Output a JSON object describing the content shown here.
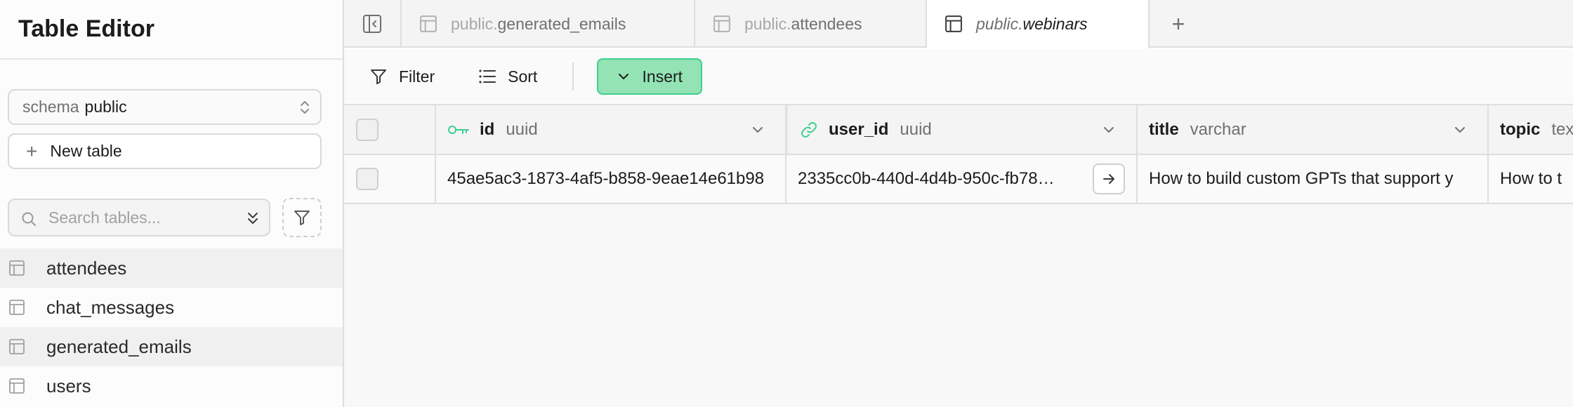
{
  "sidebar": {
    "title": "Table Editor",
    "schema": {
      "label": "schema",
      "value": "public"
    },
    "new_table_label": "New table",
    "search_placeholder": "Search tables...",
    "tables": [
      {
        "name": "attendees",
        "active": true
      },
      {
        "name": "chat_messages",
        "active": false
      },
      {
        "name": "generated_emails",
        "active": true
      },
      {
        "name": "users",
        "active": false
      }
    ]
  },
  "tabs": [
    {
      "schema": "public.",
      "name": "generated_emails",
      "active": false
    },
    {
      "schema": "public.",
      "name": "attendees",
      "active": false
    },
    {
      "schema": "public.",
      "name": "webinars",
      "active": true
    }
  ],
  "toolbar": {
    "filter_label": "Filter",
    "sort_label": "Sort",
    "insert_label": "Insert"
  },
  "grid": {
    "columns": [
      {
        "name": "id",
        "type": "uuid",
        "icon": "key-icon"
      },
      {
        "name": "user_id",
        "type": "uuid",
        "icon": "link-icon"
      },
      {
        "name": "title",
        "type": "varchar"
      },
      {
        "name": "topic",
        "type": "tex"
      }
    ],
    "rows": [
      {
        "id": "45ae5ac3-1873-4af5-b858-9eae14e61b98",
        "user_id": "2335cc0b-440d-4d4b-950c-fb78…",
        "title": "How to build custom GPTs that support y",
        "topic": "How to t"
      }
    ]
  },
  "colors": {
    "accent": "#3ecf8e",
    "insert_bg": "#93e3b4",
    "border": "#dedede"
  }
}
